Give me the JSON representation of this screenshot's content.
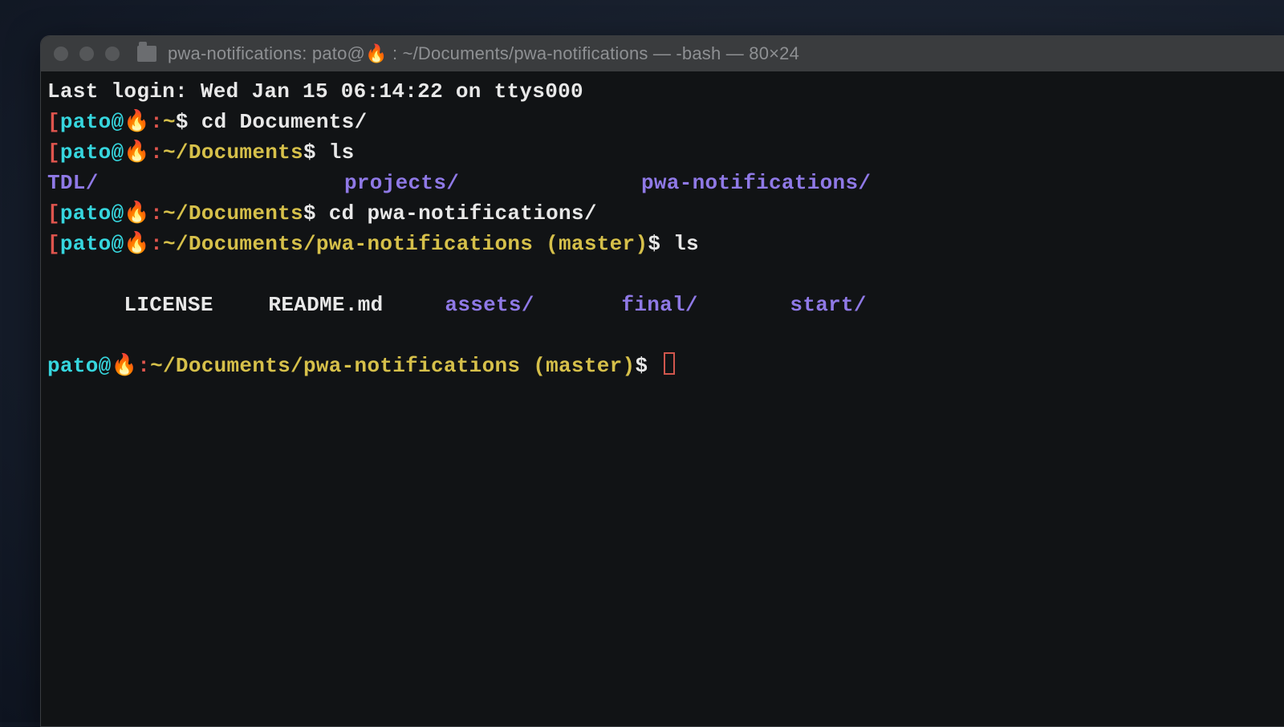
{
  "window": {
    "title_prefix": "pwa-notifications: pato@",
    "emoji": "🔥",
    "title_suffix": " : ~/Documents/pwa-notifications — -bash — 80×24"
  },
  "session": {
    "last_login": "Last login: Wed Jan 15 06:14:22 on ttys000",
    "prompts": [
      {
        "bracket": "[",
        "user": "pato@",
        "emoji": "🔥",
        "sep": ":",
        "path": "~",
        "branch": "",
        "dollar": "$ ",
        "cmd": "cd Documents/"
      },
      {
        "bracket": "[",
        "user": "pato@",
        "emoji": "🔥",
        "sep": ":",
        "path": "~/Documents",
        "branch": "",
        "dollar": "$ ",
        "cmd": "ls"
      }
    ],
    "ls_docs": [
      "TDL/",
      "projects/",
      "pwa-notifications/"
    ],
    "prompt3": {
      "bracket": "[",
      "user": "pato@",
      "emoji": "🔥",
      "sep": ":",
      "path": "~/Documents",
      "branch": "",
      "dollar": "$ ",
      "cmd": "cd pwa-notifications/"
    },
    "prompt4": {
      "bracket": "[",
      "user": "pato@",
      "emoji": "🔥",
      "sep": ":",
      "path": "~/Documents/pwa-notifications",
      "branch_open": " (",
      "branch": "master",
      "branch_close": ")",
      "dollar": "$ ",
      "cmd": "ls"
    },
    "ls_pwa_files": [
      "LICENSE",
      "README.md"
    ],
    "ls_pwa_dirs": [
      "assets/",
      "final/",
      "start/"
    ],
    "prompt5": {
      "user": "pato@",
      "emoji": "🔥",
      "sep": ":",
      "path": "~/Documents/pwa-notifications",
      "branch_open": " (",
      "branch": "master",
      "branch_close": ")",
      "dollar": "$ "
    }
  }
}
